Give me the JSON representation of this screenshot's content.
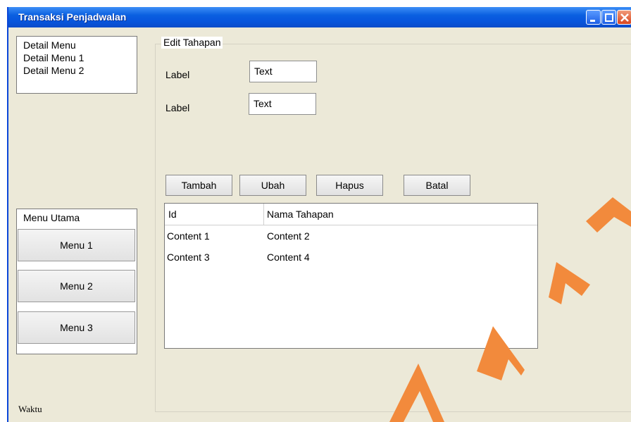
{
  "window": {
    "title": "Transaksi Penjadwalan"
  },
  "detail_menu": {
    "items": [
      "Detail Menu",
      "Detail Menu 1",
      "Detail Menu 2"
    ]
  },
  "main_menu": {
    "title": "Menu Utama",
    "buttons": [
      "Menu 1",
      "Menu 2",
      "Menu 3"
    ]
  },
  "edit_group": {
    "legend": "Edit Tahapan",
    "fields": [
      {
        "label": "Label",
        "value": "Text"
      },
      {
        "label": "Label",
        "value": "Text"
      }
    ]
  },
  "actions": {
    "add": "Tambah",
    "edit": "Ubah",
    "delete": "Hapus",
    "cancel": "Batal"
  },
  "table": {
    "columns": [
      "Id",
      "Nama Tahapan"
    ],
    "rows": [
      [
        "Content 1",
        "Content 2"
      ],
      [
        "Content 3",
        "Content 4"
      ]
    ]
  },
  "status": {
    "time_label": "Waktu"
  },
  "colors": {
    "titlebar": "#0a5fe0",
    "window_bg": "#ece9d8",
    "watermark": "#f28a3c"
  },
  "icons": {
    "minimize": "minimize-icon",
    "maximize": "maximize-icon",
    "close": "close-icon"
  }
}
